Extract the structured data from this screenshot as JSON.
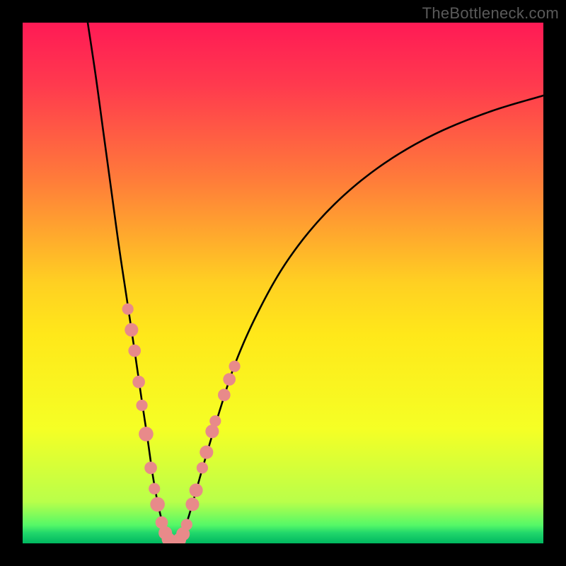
{
  "watermark": "TheBottleneck.com",
  "chart_data": {
    "type": "line",
    "title": "",
    "xlabel": "",
    "ylabel": "",
    "xlim": [
      0,
      100
    ],
    "ylim": [
      0,
      100
    ],
    "grid": false,
    "legend": false,
    "annotations": [],
    "background_gradient": {
      "stops": [
        {
          "pos": 0.0,
          "color": "#ff1a55"
        },
        {
          "pos": 0.12,
          "color": "#ff3a4e"
        },
        {
          "pos": 0.3,
          "color": "#ff7b3a"
        },
        {
          "pos": 0.5,
          "color": "#ffd022"
        },
        {
          "pos": 0.6,
          "color": "#ffe81a"
        },
        {
          "pos": 0.78,
          "color": "#f5ff25"
        },
        {
          "pos": 0.92,
          "color": "#b9ff4a"
        },
        {
          "pos": 0.965,
          "color": "#55f867"
        },
        {
          "pos": 0.98,
          "color": "#21d66b"
        },
        {
          "pos": 1.0,
          "color": "#00b860"
        }
      ]
    },
    "series": [
      {
        "name": "bottleneck-curve",
        "color": "#000000",
        "x": [
          12.5,
          14.0,
          15.5,
          17.0,
          18.5,
          20.0,
          21.5,
          22.8,
          24.0,
          25.0,
          26.0,
          27.0,
          28.0,
          29.0,
          30.0,
          31.5,
          33.0,
          35.0,
          38.0,
          41.0,
          45.0,
          50.0,
          56.0,
          63.0,
          71.0,
          80.0,
          90.0,
          100.0
        ],
        "y": [
          100.0,
          90.0,
          79.0,
          68.0,
          57.0,
          47.0,
          37.0,
          28.0,
          20.0,
          13.0,
          7.5,
          3.5,
          1.0,
          0.0,
          1.0,
          4.0,
          9.0,
          16.0,
          26.0,
          35.0,
          44.0,
          53.0,
          61.0,
          68.0,
          74.0,
          79.0,
          83.0,
          86.0
        ]
      }
    ],
    "markers": {
      "name": "highlighted-points",
      "color": "#e88a8a",
      "radius_style": "irregular",
      "points": [
        {
          "x": 20.2,
          "y": 45.0,
          "r": 1.1
        },
        {
          "x": 20.9,
          "y": 41.0,
          "r": 1.3
        },
        {
          "x": 21.5,
          "y": 37.0,
          "r": 1.2
        },
        {
          "x": 22.3,
          "y": 31.0,
          "r": 1.2
        },
        {
          "x": 22.9,
          "y": 26.5,
          "r": 1.1
        },
        {
          "x": 23.7,
          "y": 21.0,
          "r": 1.4
        },
        {
          "x": 24.6,
          "y": 14.5,
          "r": 1.2
        },
        {
          "x": 25.3,
          "y": 10.5,
          "r": 1.1
        },
        {
          "x": 25.9,
          "y": 7.5,
          "r": 1.4
        },
        {
          "x": 26.7,
          "y": 4.0,
          "r": 1.2
        },
        {
          "x": 27.4,
          "y": 2.0,
          "r": 1.3
        },
        {
          "x": 28.0,
          "y": 0.8,
          "r": 1.3
        },
        {
          "x": 28.7,
          "y": 0.2,
          "r": 1.3
        },
        {
          "x": 29.4,
          "y": 0.2,
          "r": 1.3
        },
        {
          "x": 30.1,
          "y": 0.7,
          "r": 1.3
        },
        {
          "x": 30.8,
          "y": 1.8,
          "r": 1.3
        },
        {
          "x": 31.5,
          "y": 3.6,
          "r": 1.1
        },
        {
          "x": 32.6,
          "y": 7.5,
          "r": 1.3
        },
        {
          "x": 33.3,
          "y": 10.2,
          "r": 1.3
        },
        {
          "x": 34.5,
          "y": 14.5,
          "r": 1.1
        },
        {
          "x": 35.3,
          "y": 17.5,
          "r": 1.3
        },
        {
          "x": 36.4,
          "y": 21.5,
          "r": 1.3
        },
        {
          "x": 37.0,
          "y": 23.5,
          "r": 1.1
        },
        {
          "x": 38.7,
          "y": 28.5,
          "r": 1.2
        },
        {
          "x": 39.7,
          "y": 31.5,
          "r": 1.2
        },
        {
          "x": 40.7,
          "y": 34.0,
          "r": 1.1
        }
      ]
    }
  }
}
